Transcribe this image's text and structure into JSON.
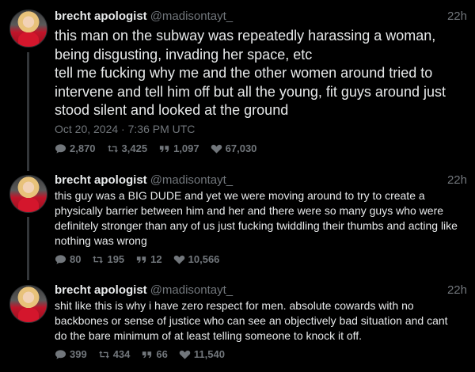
{
  "tweets": [
    {
      "name": "brecht apologist",
      "handle": "@madisontayt_",
      "time": "22h",
      "text_lines": [
        "this man on the subway was repeatedly harassing a woman,",
        "being disgusting, invading her space, etc",
        "tell me fucking why me and the other women around tried to",
        "intervene and tell him off but all the young, fit guys around just",
        "stood silent and looked at the ground"
      ],
      "timestamp": "Oct 20, 2024 · 7:36 PM UTC",
      "stats": {
        "replies": "2,870",
        "retweets": "3,425",
        "quotes": "1,097",
        "likes": "67,030"
      }
    },
    {
      "name": "brecht apologist",
      "handle": "@madisontayt_",
      "time": "22h",
      "text_lines": [
        "this guy was a BIG DUDE and yet we were moving around to try to create a",
        "physically barrier between him and her and there were so many guys who were",
        "definitely stronger than any of us just fucking twiddling their thumbs and acting like",
        "nothing was wrong"
      ],
      "stats": {
        "replies": "80",
        "retweets": "195",
        "quotes": "12",
        "likes": "10,566"
      }
    },
    {
      "name": "brecht apologist",
      "handle": "@madisontayt_",
      "time": "22h",
      "text_lines": [
        "shit like this is why i have zero respect for men. absolute cowards with no",
        "backbones or sense of justice who can see an objectively bad situation and cant",
        "do the bare minimum of at least telling someone to knock it off."
      ],
      "stats": {
        "replies": "399",
        "retweets": "434",
        "quotes": "66",
        "likes": "11,540"
      }
    }
  ],
  "icons": [
    "reply-icon",
    "retweet-icon",
    "quote-icon",
    "like-icon"
  ],
  "colors": {
    "background": "#000000",
    "text": "#e7e9ea",
    "muted": "#71767b",
    "thread_line": "#333639"
  }
}
